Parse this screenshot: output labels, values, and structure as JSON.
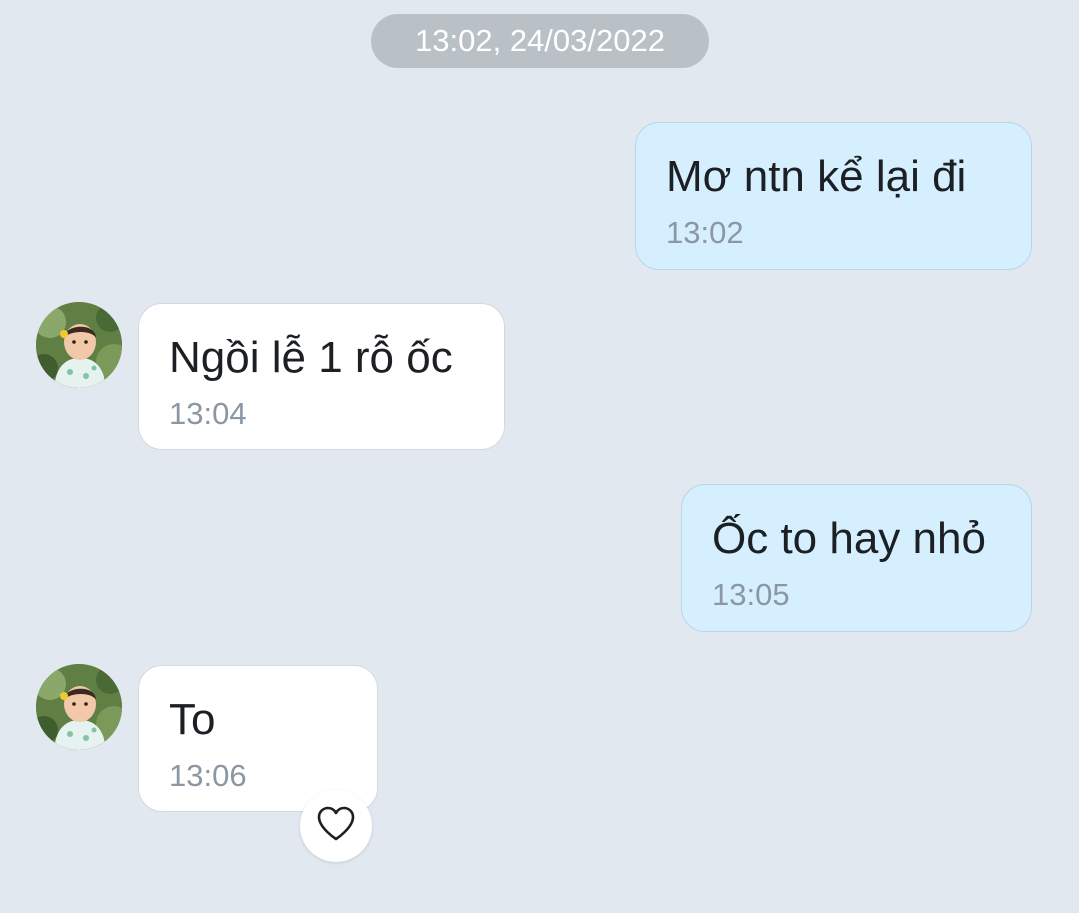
{
  "date_separator": "13:02, 24/03/2022",
  "messages": [
    {
      "sender": "me",
      "text": "Mơ ntn kể lại đi",
      "time": "13:02"
    },
    {
      "sender": "contact",
      "text": "Ngồi lễ 1 rỗ ốc",
      "time": "13:04"
    },
    {
      "sender": "me",
      "text": "Ốc to hay nhỏ",
      "time": "13:05"
    },
    {
      "sender": "contact",
      "text": "To",
      "time": "13:06"
    }
  ],
  "reaction": {
    "icon": "heart-outline-icon"
  },
  "colors": {
    "background": "#e2e8f0",
    "outgoing_bubble": "#d5effe",
    "incoming_bubble": "#ffffff",
    "timestamp": "#8b97a3"
  }
}
